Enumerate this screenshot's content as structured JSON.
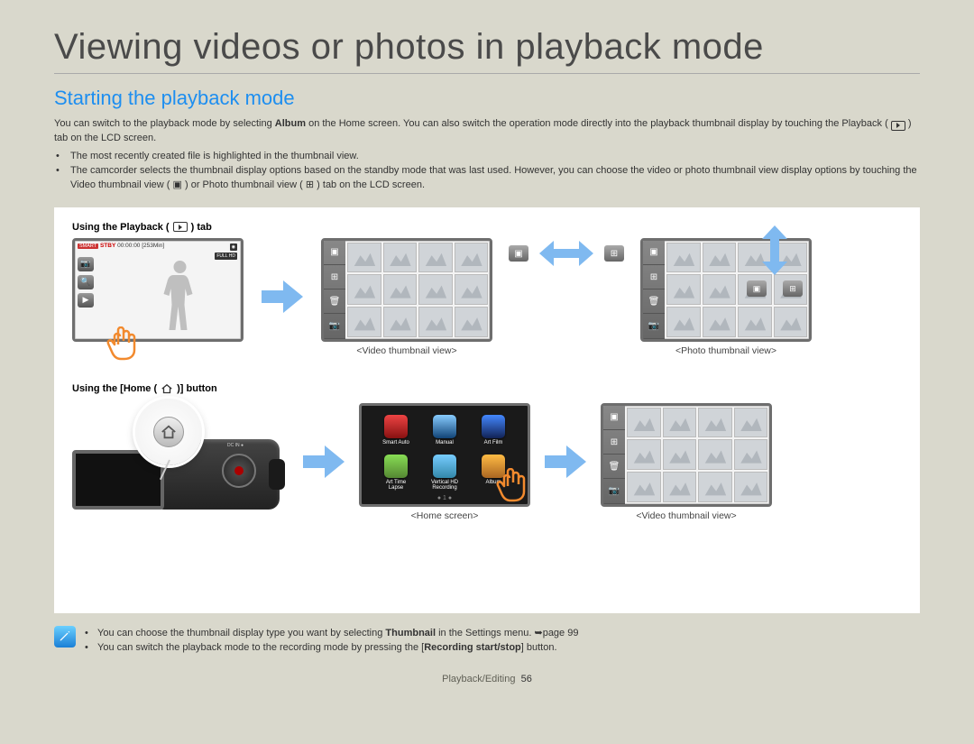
{
  "title": "Viewing videos or photos in playback mode",
  "subtitle": "Starting the playback mode",
  "intro_p1a": "You can switch to the playback mode by selecting ",
  "intro_p1_bold": "Album",
  "intro_p1b": " on the Home screen. You can also switch the operation mode directly into the playback thumbnail display by touching the Playback ( ",
  "intro_p1c": " ) tab on the LCD screen.",
  "bullet1": "The most recently created file is highlighted in the thumbnail view.",
  "bullet2a": "The camcorder selects the thumbnail display options based on the standby mode that was last used. However, you can choose the video or photo thumbnail view display options by touching the Video thumbnail view ( ",
  "bullet2b": " ) or Photo thumbnail view ( ",
  "bullet2c": " ) tab on the LCD screen.",
  "section1_label_a": "Using the Playback ( ",
  "section1_label_b": " ) tab",
  "section2_label_a": "Using the [Home ( ",
  "section2_label_b": " )] button",
  "standby": {
    "stby": "STBY",
    "time": "00:00:00 [253Min]",
    "badge1": "◉",
    "badge2": "FULL HD"
  },
  "captions": {
    "video_thumb": "<Video thumbnail view>",
    "photo_thumb": "<Photo thumbnail view>",
    "home": "<Home screen>"
  },
  "home_apps": [
    "Smart Auto",
    "Manual",
    "Art Film",
    "Art Time\nLapse",
    "Vertical HD\nRecording",
    "Album"
  ],
  "home_pager": "● 1 ●",
  "cam_label": "DC IN ●",
  "note1a": "You can choose the thumbnail display type you want by selecting ",
  "note1_bold": "Thumbnail",
  "note1b": " in the Settings menu. ➥page 99",
  "note2a": "You can switch the playback mode to the recording mode by pressing the [",
  "note2_bold": "Recording start/stop",
  "note2b": "] button.",
  "footer_a": "Playback/Editing",
  "footer_pg": "56"
}
